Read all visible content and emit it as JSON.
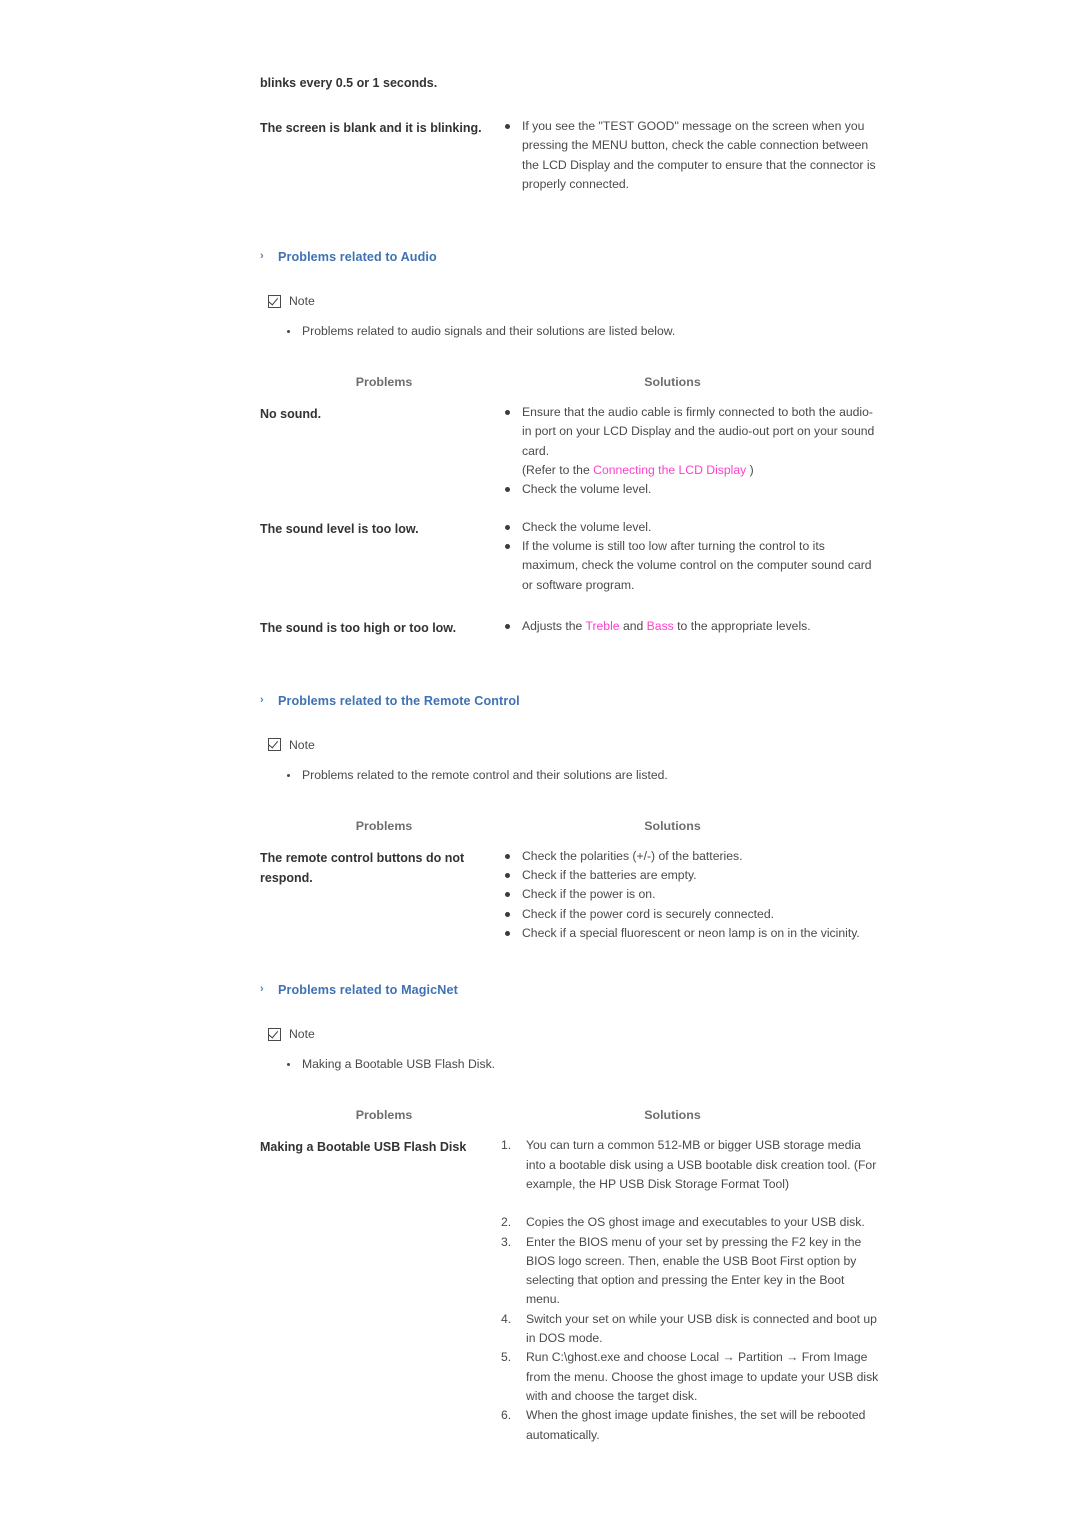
{
  "intro": {
    "line1": "blinks every 0.5 or 1 seconds.",
    "problem": "The screen is blank and it is blinking.",
    "solution": "If you see the \"TEST GOOD\" message on the screen when you pressing the MENU button, check the cable connection between the LCD Display and the computer to ensure that the connector is properly connected."
  },
  "table_headers": {
    "problems": "Problems",
    "solutions": "Solutions"
  },
  "note": {
    "label": "Note",
    "icon": "checked-checkbox-icon"
  },
  "colors": {
    "heading_blue": "#3f72b5",
    "link_magenta": "#ff3fcb",
    "header_gray": "#6e6e6e",
    "body_gray": "#4a4a4a"
  },
  "audio": {
    "heading": "Problems related to Audio",
    "marker": "›",
    "note_bullet": "Problems related to audio signals and their solutions are listed below.",
    "rows": [
      {
        "problem": "No sound.",
        "bullets": [
          {
            "lines": [
              "Ensure that the audio cable is firmly connected to both the",
              "audio-in port on your LCD Display and the audio-out port on",
              "your sound card."
            ],
            "refer_prefix": "(Refer to the ",
            "refer_link": "Connecting the LCD Display",
            "refer_suffix": " )"
          },
          {
            "lines": [
              "Check the volume level."
            ]
          }
        ]
      },
      {
        "problem": "The sound level is too low.",
        "bullets": [
          {
            "lines": [
              "Check the volume level."
            ]
          },
          {
            "lines": [
              "If the volume is still too low after turning the control to its",
              "maximum, check the volume control on the computer sound",
              "card or software program."
            ]
          }
        ]
      },
      {
        "problem": "The sound is too high or too low.",
        "bullets": [
          {
            "pre": "Adjusts the ",
            "link1": "Treble",
            "mid": " and ",
            "link2": "Bass",
            "post": " to the appropriate levels."
          }
        ]
      }
    ]
  },
  "remote": {
    "heading": "Problems related to the Remote Control",
    "marker": "›",
    "note_bullet": "Problems related to the remote control and their solutions are listed.",
    "row": {
      "problem": "The remote control buttons do not respond.",
      "bullets": [
        "Check the polarities (+/-) of the batteries.",
        "Check if the batteries are empty.",
        "Check if the power is on.",
        "Check if the power cord is securely connected.",
        "Check if a special fluorescent or neon lamp is on in the vicinity."
      ]
    }
  },
  "magicnet": {
    "heading": "Problems related to MagicNet",
    "marker": "›",
    "note_bullet": "Making a Bootable USB Flash Disk.",
    "row": {
      "problem": "Making a Bootable USB Flash Disk",
      "steps": [
        "You can turn a common 512-MB or bigger USB storage media into a bootable disk using a USB bootable disk creation tool. (For example, the HP USB Disk Storage Format Tool)",
        "Copies the OS ghost image and executables to your USB disk.",
        "Enter the BIOS menu of your set by pressing the F2 key in the BIOS logo screen. Then, enable the USB Boot First option by selecting that option and pressing the Enter key in the Boot menu.",
        "Switch your set on while your USB disk is connected and boot up in DOS mode.",
        "Run C:\\ghost.exe and choose Local → Partition → From Image from the menu. Choose the ghost image to update your USB disk with and choose the target disk.",
        "When the ghost image update finishes, the set will be rebooted automatically."
      ]
    }
  }
}
